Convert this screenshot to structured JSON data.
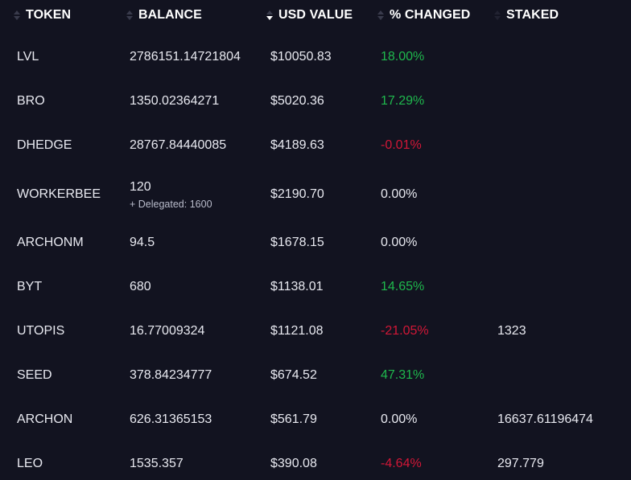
{
  "header": {
    "columns": [
      {
        "label": "TOKEN",
        "sorted": false
      },
      {
        "label": "BALANCE",
        "sorted": false
      },
      {
        "label": "USD VALUE",
        "sorted": "desc"
      },
      {
        "label": "% CHANGED",
        "sorted": false
      },
      {
        "label": "STAKED",
        "sorted": false
      }
    ]
  },
  "colors": {
    "background": "#121320",
    "positive": "#1fb84d",
    "negative": "#d21737",
    "text": "#e8e9f0"
  },
  "rows": [
    {
      "token": "LVL",
      "balance": "2786151.14721804",
      "delegated": "",
      "usd": "$10050.83",
      "change": "18.00%",
      "trend": "pos",
      "staked": ""
    },
    {
      "token": "BRO",
      "balance": "1350.02364271",
      "delegated": "",
      "usd": "$5020.36",
      "change": "17.29%",
      "trend": "pos",
      "staked": ""
    },
    {
      "token": "DHEDGE",
      "balance": "28767.84440085",
      "delegated": "",
      "usd": "$4189.63",
      "change": "-0.01%",
      "trend": "neg",
      "staked": ""
    },
    {
      "token": "WORKERBEE",
      "balance": "120",
      "delegated": "+ Delegated: 1600",
      "usd": "$2190.70",
      "change": "0.00%",
      "trend": "neu",
      "staked": ""
    },
    {
      "token": "ARCHONM",
      "balance": "94.5",
      "delegated": "",
      "usd": "$1678.15",
      "change": "0.00%",
      "trend": "neu",
      "staked": ""
    },
    {
      "token": "BYT",
      "balance": "680",
      "delegated": "",
      "usd": "$1138.01",
      "change": "14.65%",
      "trend": "pos",
      "staked": ""
    },
    {
      "token": "UTOPIS",
      "balance": "16.77009324",
      "delegated": "",
      "usd": "$1121.08",
      "change": "-21.05%",
      "trend": "neg",
      "staked": "1323"
    },
    {
      "token": "SEED",
      "balance": "378.84234777",
      "delegated": "",
      "usd": "$674.52",
      "change": "47.31%",
      "trend": "pos",
      "staked": ""
    },
    {
      "token": "ARCHON",
      "balance": "626.31365153",
      "delegated": "",
      "usd": "$561.79",
      "change": "0.00%",
      "trend": "neu",
      "staked": "16637.61196474"
    },
    {
      "token": "LEO",
      "balance": "1535.357",
      "delegated": "",
      "usd": "$390.08",
      "change": "-4.64%",
      "trend": "neg",
      "staked": "297.779"
    }
  ]
}
